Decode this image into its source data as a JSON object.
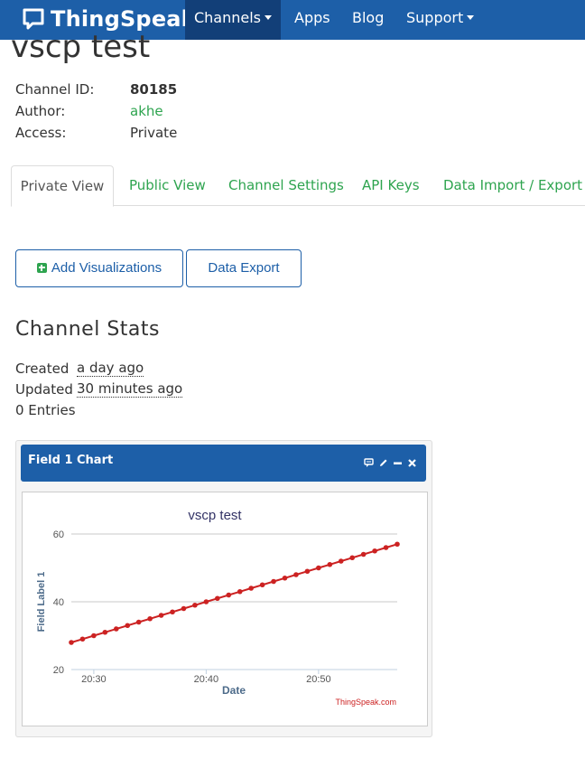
{
  "navbar": {
    "brand": "ThingSpeak",
    "items": [
      {
        "label": "Channels",
        "has_caret": true,
        "active": true
      },
      {
        "label": "Apps"
      },
      {
        "label": "Blog"
      },
      {
        "label": "Support",
        "has_caret": true
      }
    ],
    "bg_color": "#1d5fa8",
    "active_color": "#123f78"
  },
  "channel": {
    "title": "vscp test",
    "fields": [
      {
        "label": "Channel ID:",
        "value": "80185"
      },
      {
        "label": "Author:",
        "value": "akhe"
      },
      {
        "label": "Access:",
        "value": "Private"
      }
    ]
  },
  "tabs": [
    {
      "label": "Private View",
      "active": true
    },
    {
      "label": "Public View"
    },
    {
      "label": "Channel Settings"
    },
    {
      "label": "API Keys"
    },
    {
      "label": "Data Import / Export"
    }
  ],
  "buttons": {
    "add_visualizations": "Add Visualizations",
    "data_export": "Data Export"
  },
  "stats": {
    "title": "Channel Stats",
    "created_label": "Created",
    "created_value": "a day ago",
    "updated_label": "Updated",
    "updated_value": "30 minutes ago",
    "entries": "0 Entries"
  },
  "panel": {
    "title": "Field 1 Chart",
    "icons": [
      "comment-icon",
      "pencil-icon",
      "minimize-icon",
      "close-icon"
    ]
  },
  "chart_data": {
    "type": "line",
    "title": "vscp test",
    "xlabel": "Date",
    "ylabel": "Field Label 1",
    "credit": "ThingSpeak.com",
    "x_ticks": [
      "20:30",
      "20:40",
      "20:50"
    ],
    "y_ticks": [
      20,
      40,
      60
    ],
    "ylim": [
      20,
      60
    ],
    "x_start_label": "20:28",
    "series": [
      {
        "color": "#cc2222",
        "x": [
          "20:28",
          "20:29",
          "20:30",
          "20:31",
          "20:32",
          "20:33",
          "20:34",
          "20:35",
          "20:36",
          "20:37",
          "20:38",
          "20:39",
          "20:40",
          "20:41",
          "20:42",
          "20:43",
          "20:44",
          "20:45",
          "20:46",
          "20:47",
          "20:48",
          "20:49",
          "20:50",
          "20:51",
          "20:52",
          "20:53",
          "20:54",
          "20:55",
          "20:56",
          "20:57"
        ],
        "values": [
          28,
          29,
          30,
          31,
          32,
          33,
          34,
          35,
          36,
          37,
          38,
          39,
          40,
          41,
          42,
          43,
          44,
          45,
          46,
          47,
          48,
          49,
          50,
          51,
          52,
          53,
          54,
          55,
          56,
          57
        ]
      }
    ],
    "grid": true
  }
}
